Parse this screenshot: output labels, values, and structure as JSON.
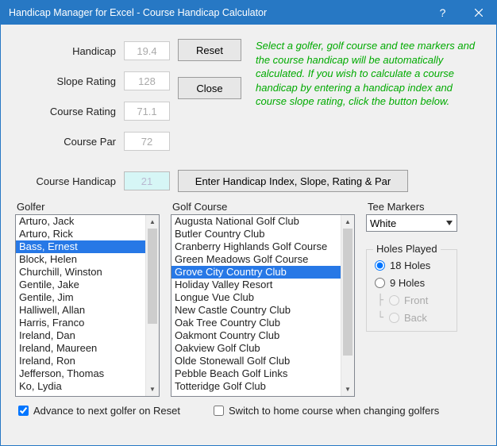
{
  "window": {
    "title": "Handicap Manager for Excel - Course Handicap Calculator"
  },
  "fields": {
    "handicap_label": "Handicap",
    "handicap_value": "19.4",
    "slope_label": "Slope Rating",
    "slope_value": "128",
    "course_rating_label": "Course Rating",
    "course_rating_value": "71.1",
    "course_par_label": "Course Par",
    "course_par_value": "72",
    "course_handicap_label": "Course Handicap",
    "course_handicap_value": "21"
  },
  "buttons": {
    "reset": "Reset",
    "close": "Close",
    "enter_hi": "Enter Handicap Index, Slope, Rating & Par"
  },
  "help_text": "Select a golfer, golf course and tee markers and the course handicap will be automatically calculated. If you wish to calculate a course handicap by entering a handicap index and course slope rating, click the button below.",
  "golfer": {
    "label": "Golfer",
    "items": [
      "Arturo, Jack",
      "Arturo, Rick",
      "Bass, Ernest",
      "Block, Helen",
      "Churchill, Winston",
      "Gentile, Jake",
      "Gentile, Jim",
      "Halliwell, Allan",
      "Harris, Franco",
      "Ireland, Dan",
      "Ireland, Maureen",
      "Ireland, Ron",
      "Jefferson, Thomas",
      "Ko, Lydia"
    ],
    "selected_index": 2
  },
  "course": {
    "label": "Golf Course",
    "items": [
      "Augusta National Golf Club",
      "Butler Country Club",
      "Cranberry Highlands Golf Course",
      "Green Meadows Golf Course",
      "Grove City Country Club",
      "Holiday Valley Resort",
      "Longue Vue Club",
      "New Castle Country Club",
      "Oak Tree Country Club",
      "Oakmont Country Club",
      "Oakview Golf Club",
      "Olde Stonewall Golf Club",
      "Pebble Beach Golf Links",
      "Totteridge Golf Club"
    ],
    "selected_index": 4
  },
  "tee": {
    "label": "Tee Markers",
    "selected": "White"
  },
  "holes": {
    "legend": "Holes Played",
    "opt18": "18 Holes",
    "opt9": "9 Holes",
    "front": "Front",
    "back": "Back"
  },
  "checks": {
    "advance": "Advance to next golfer on Reset",
    "switch_home": "Switch to home course when changing golfers"
  }
}
